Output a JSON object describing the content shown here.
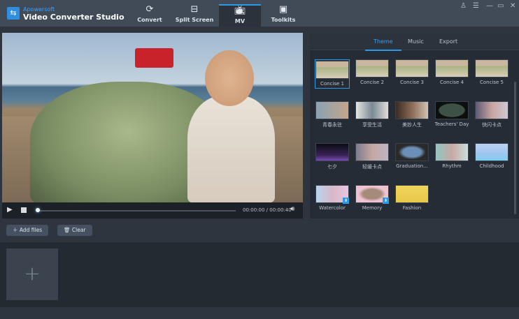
{
  "app": {
    "brand": "Apowersoft",
    "title": "Video Converter Studio"
  },
  "nav": [
    {
      "label": "Convert",
      "icon": "refresh-icon"
    },
    {
      "label": "Split Screen",
      "icon": "split-screen-icon"
    },
    {
      "label": "MV",
      "icon": "tv-icon",
      "active": true
    },
    {
      "label": "Toolkits",
      "icon": "toolbox-icon"
    }
  ],
  "window": {
    "icons": [
      "user-icon",
      "menu-icon",
      "minimize-icon",
      "maximize-icon",
      "close-icon"
    ]
  },
  "player": {
    "time": "00:00:00 / 00:00:40",
    "progress": 0
  },
  "panel": {
    "tabs": [
      "Theme",
      "Music",
      "Export"
    ],
    "active_tab": "Theme",
    "themes": [
      {
        "label": "Concise 1",
        "selected": true
      },
      {
        "label": "Concise 2"
      },
      {
        "label": "Concise 3"
      },
      {
        "label": "Concise 4"
      },
      {
        "label": "Concise 5"
      },
      {
        "label": "青春永驻"
      },
      {
        "label": "享受生活"
      },
      {
        "label": "美妙人生"
      },
      {
        "label": "Teachers' Day"
      },
      {
        "label": "快闪卡点"
      },
      {
        "label": "七夕"
      },
      {
        "label": "轻缓卡点"
      },
      {
        "label": "Graduation..."
      },
      {
        "label": "Rhythm"
      },
      {
        "label": "Childhood"
      },
      {
        "label": "Watercolor",
        "download": true
      },
      {
        "label": "Memory",
        "download": true
      },
      {
        "label": "Fashion"
      }
    ]
  },
  "toolbar": {
    "add_files": "Add files",
    "clear": "Clear"
  },
  "colors": {
    "accent": "#2b9be6",
    "titlebar": "#414b58"
  }
}
